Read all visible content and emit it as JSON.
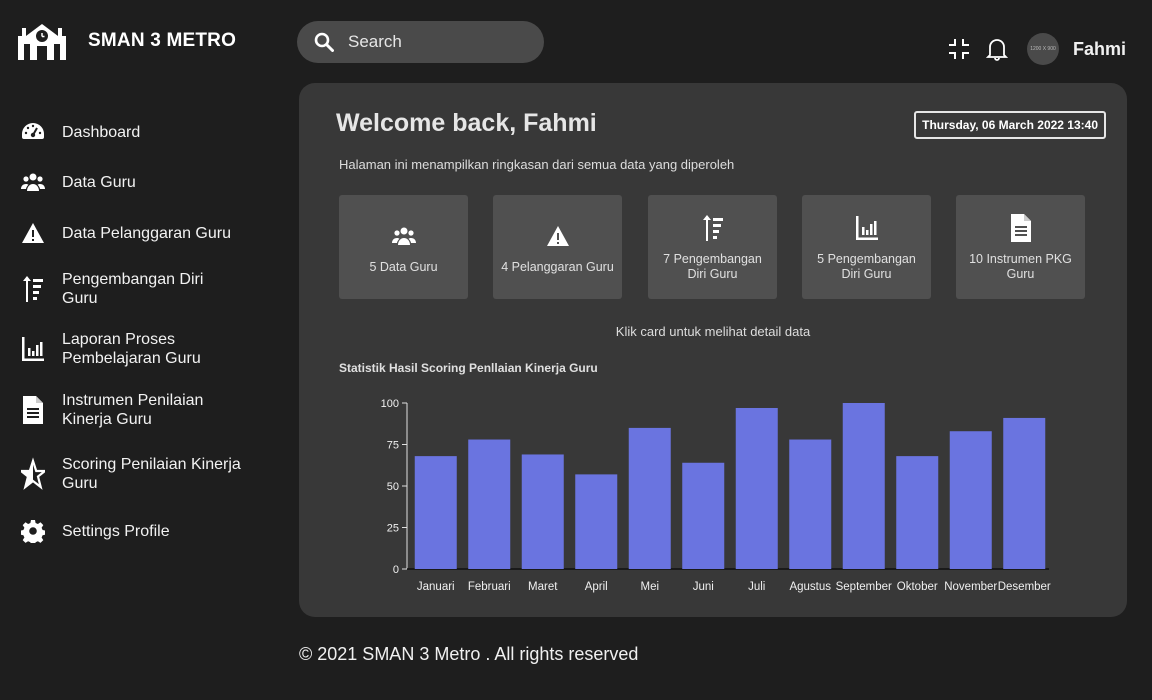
{
  "brand": {
    "name": "SMAN 3 METRO"
  },
  "sidebar": {
    "items": [
      {
        "label": "Dashboard",
        "icon": "gauge-icon"
      },
      {
        "label": "Data Guru",
        "icon": "users-icon"
      },
      {
        "label": "Data Pelanggaran Guru",
        "icon": "warning-icon"
      },
      {
        "label": "Pengembangan Diri Guru",
        "icon": "sort-up-icon"
      },
      {
        "label": "Laporan Proses Pembelajaran Guru",
        "icon": "chart-icon"
      },
      {
        "label": "Instrumen Penilaian Kinerja Guru",
        "icon": "document-icon"
      },
      {
        "label": "Scoring Penilaian Kinerja Guru",
        "icon": "star-icon"
      },
      {
        "label": "Settings Profile",
        "icon": "gear-icon"
      }
    ]
  },
  "header": {
    "search_placeholder": "Search",
    "avatar_text": "1200 X 900",
    "user_name": "Fahmi"
  },
  "main": {
    "welcome": "Welcome back, Fahmi",
    "datetime": "Thursday, 06 March 2022 13:40",
    "subtitle": "Halaman ini menampilkan ringkasan dari semua data  yang diperoleh",
    "cards": [
      {
        "label": "5 Data Guru",
        "icon": "users-icon"
      },
      {
        "label": "4 Pelanggaran Guru",
        "icon": "warning-icon"
      },
      {
        "label": "7 Pengembangan Diri Guru",
        "icon": "sort-up-icon"
      },
      {
        "label": "5 Pengembangan Diri Guru",
        "icon": "chart-icon"
      },
      {
        "label": "10 Instrumen PKG Guru",
        "icon": "document-icon"
      }
    ],
    "hint": "Klik card untuk melihat detail data"
  },
  "chart_data": {
    "type": "bar",
    "title": "Statistik Hasil Scoring Penllaian Kinerja Guru",
    "categories": [
      "Januari",
      "Februari",
      "Maret",
      "April",
      "Mei",
      "Juni",
      "Juli",
      "Agustus",
      "September",
      "Oktober",
      "November",
      "Desember"
    ],
    "values": [
      68,
      78,
      69,
      57,
      85,
      64,
      97,
      78,
      100,
      68,
      83,
      91
    ],
    "yticks": [
      0,
      25,
      50,
      75,
      100
    ],
    "ylim": [
      0,
      100
    ],
    "bar_color": "#6a74e0",
    "grid": false
  },
  "footer": {
    "text": "© 2021 SMAN 3 Metro . All rights reserved"
  }
}
